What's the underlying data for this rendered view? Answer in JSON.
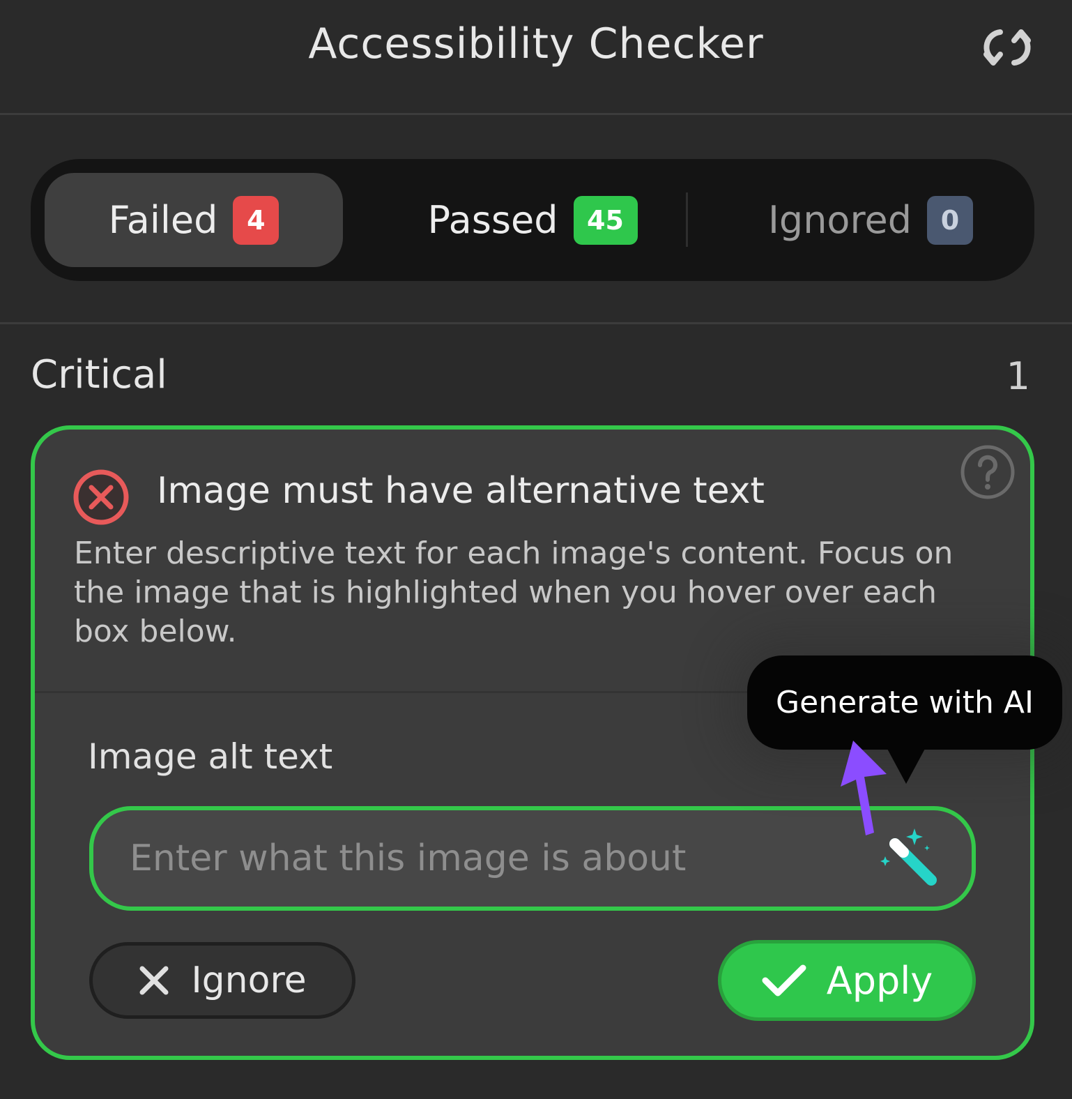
{
  "header": {
    "title": "Accessibility Checker",
    "refresh_icon": "refresh-icon"
  },
  "tabs": [
    {
      "label": "Failed",
      "count": "4",
      "color": "#e64a4a",
      "selected": true
    },
    {
      "label": "Passed",
      "count": "45",
      "color": "#2fc74c",
      "selected": false
    },
    {
      "label": "Ignored",
      "count": "0",
      "color": "#4a5870",
      "selected": false
    }
  ],
  "section": {
    "title": "Critical",
    "count": "1"
  },
  "issue": {
    "status_icon": "error-icon",
    "help_icon": "help-icon",
    "title": "Image must have alternative text",
    "description": "Enter descriptive text for each image's content. Focus on the image that is highlighted when you hover over each box below.",
    "field_label": "Image alt text",
    "input_value": "",
    "input_placeholder": "Enter what this image is about",
    "ai_icon": "magic-wand-icon",
    "tooltip": "Generate with AI",
    "ignore_label": "Ignore",
    "apply_label": "Apply"
  },
  "colors": {
    "accent_green": "#34c84a",
    "background": "#2a2a2a",
    "card_background": "#3c3c3c",
    "pointer_purple": "#8b4dff"
  }
}
